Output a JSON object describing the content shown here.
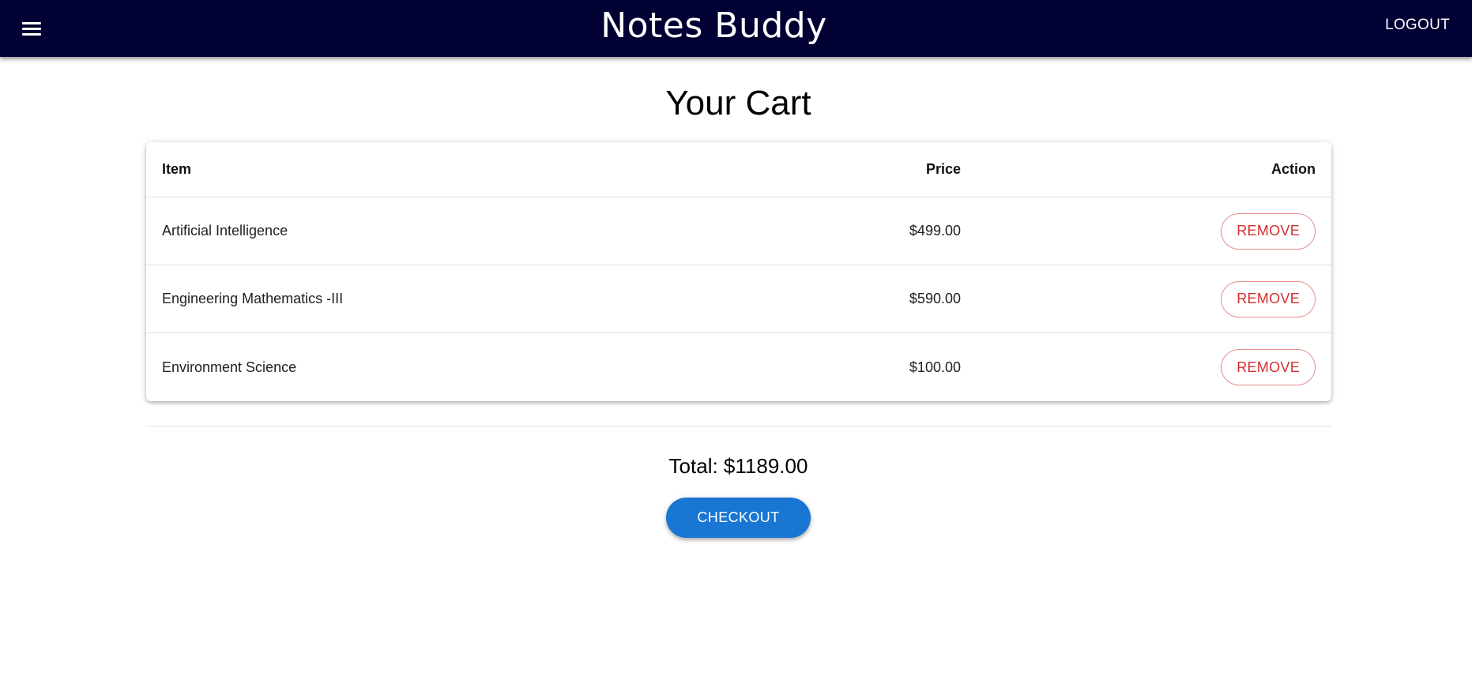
{
  "appbar": {
    "title": "Notes Buddy",
    "menu_icon": "hamburger-menu-icon",
    "logout_label": "LOGOUT",
    "background_color": "#000033"
  },
  "cart": {
    "title": "Your Cart",
    "columns": {
      "item": "Item",
      "price": "Price",
      "action": "Action"
    },
    "rows": [
      {
        "item": "Artificial Intelligence",
        "price": "$499.00",
        "action_label": "REMOVE"
      },
      {
        "item": "Engineering Mathematics -III",
        "price": "$590.00",
        "action_label": "REMOVE"
      },
      {
        "item": "Environment Science",
        "price": "$100.00",
        "action_label": "REMOVE"
      }
    ],
    "remove_color": "#d32f2f"
  },
  "summary": {
    "total_text": "Total: $1189.00",
    "checkout_label": "CHECKOUT",
    "checkout_color": "#1976d2"
  }
}
